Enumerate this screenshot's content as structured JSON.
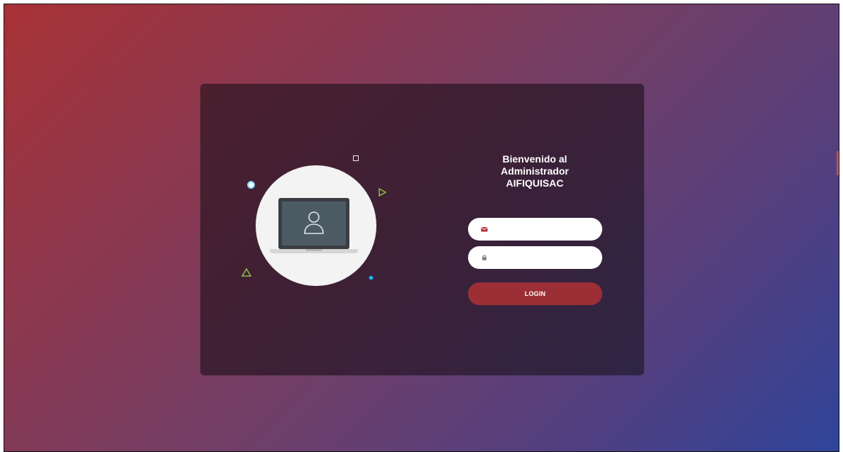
{
  "login": {
    "heading_lines": [
      "Bienvenido al",
      "Administrador",
      "AIFIQUISAC"
    ],
    "email_field": {
      "icon": "envelope-icon",
      "value": "",
      "placeholder": ""
    },
    "password_field": {
      "icon": "lock-icon",
      "value": "",
      "placeholder": ""
    },
    "login_button_label": "LOGIN"
  },
  "illustration": {
    "icons": [
      "laptop-icon",
      "user-icon"
    ]
  },
  "colors": {
    "accent": "#9b2f35",
    "card_background": "#3e2035",
    "background_start": "#a83236",
    "background_end": "#2f4499",
    "deco_cyan": "#33b6ff",
    "deco_green": "#8bc34a"
  }
}
